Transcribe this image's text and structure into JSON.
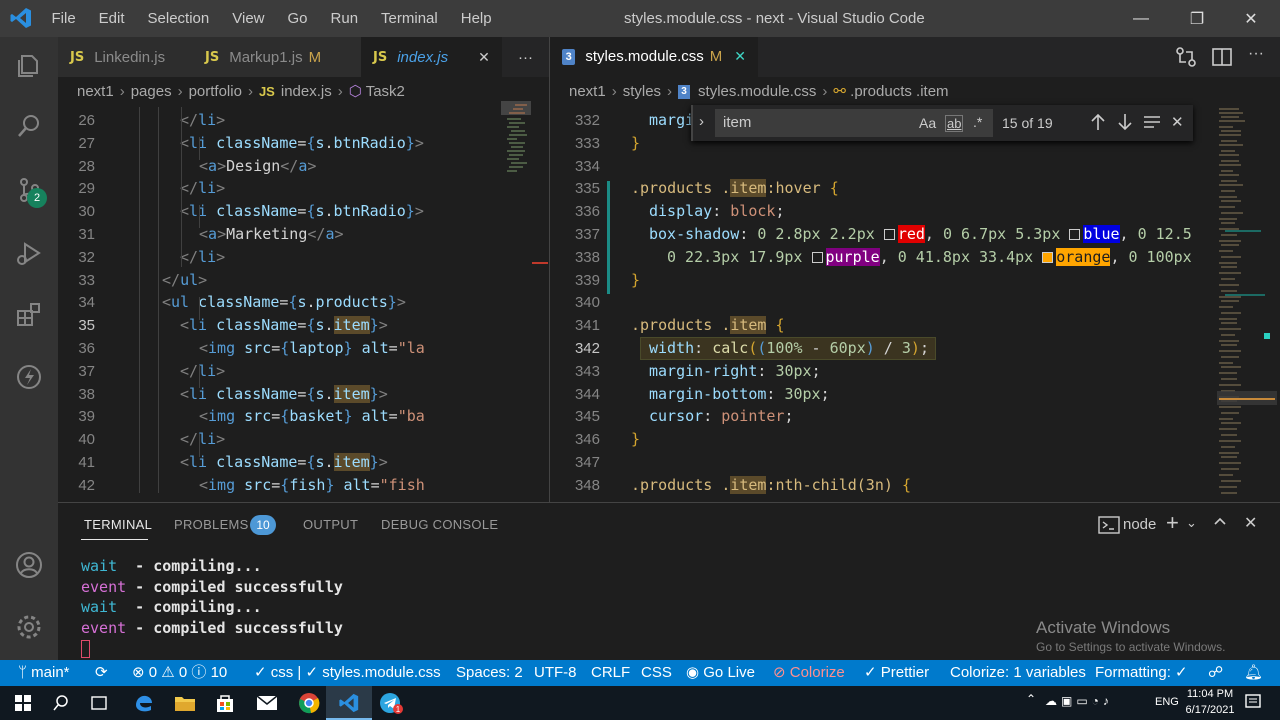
{
  "titlebar": {
    "menu": [
      "File",
      "Edit",
      "Selection",
      "View",
      "Go",
      "Run",
      "Terminal",
      "Help"
    ],
    "title": "styles.module.css - next - Visual Studio Code",
    "min": "—",
    "max": "❐",
    "close": "✕"
  },
  "left_tabs": [
    {
      "icon": "JS",
      "label": "Linkedin.js",
      "mod": ""
    },
    {
      "icon": "JS",
      "label": "Markup1.js",
      "mod": "M"
    },
    {
      "icon": "JS",
      "label": "index.js",
      "mod": "",
      "close": "✕"
    }
  ],
  "left_more": "···",
  "left_crumbs": {
    "a": "next1",
    "b": "pages",
    "c": "portfolio",
    "d": "JS",
    "e": "index.js",
    "f": "Task2"
  },
  "left_code": [
    {
      "n": "26",
      "h": "<span class='tg'>&lt;/</span><span class='tn'>li</span><span class='tg'>&gt;</span>",
      "i": 180
    },
    {
      "n": "27",
      "h": "<span class='tg'>&lt;</span><span class='tn'>li</span> <span class='at'>className</span><span class='tx'>=</span><span class='tn'>{</span><span class='vr'>s</span><span class='tx'>.</span><span class='vr'>btnRadio</span><span class='tn'>}</span><span class='tg'>&gt;</span>",
      "i": 180
    },
    {
      "n": "28",
      "h": "<span class='tg'>&lt;</span><span class='tn'>a</span><span class='tg'>&gt;</span><span class='tx'>Design</span><span class='tg'>&lt;/</span><span class='tn'>a</span><span class='tg'>&gt;</span>",
      "i": 199
    },
    {
      "n": "29",
      "h": "<span class='tg'>&lt;/</span><span class='tn'>li</span><span class='tg'>&gt;</span>",
      "i": 180
    },
    {
      "n": "30",
      "h": "<span class='tg'>&lt;</span><span class='tn'>li</span> <span class='at'>className</span><span class='tx'>=</span><span class='tn'>{</span><span class='vr'>s</span><span class='tx'>.</span><span class='vr'>btnRadio</span><span class='tn'>}</span><span class='tg'>&gt;</span>",
      "i": 180
    },
    {
      "n": "31",
      "h": "<span class='tg'>&lt;</span><span class='tn'>a</span><span class='tg'>&gt;</span><span class='tx'>Marketing</span><span class='tg'>&lt;/</span><span class='tn'>a</span><span class='tg'>&gt;</span>",
      "i": 199
    },
    {
      "n": "32",
      "h": "<span class='tg'>&lt;/</span><span class='tn'>li</span><span class='tg'>&gt;</span>",
      "i": 180
    },
    {
      "n": "33",
      "h": "<span class='tg'>&lt;/</span><span class='tn'>ul</span><span class='tg'>&gt;</span>",
      "i": 162
    },
    {
      "n": "34",
      "h": "<span class='tg'>&lt;</span><span class='tn'>ul</span> <span class='at'>className</span><span class='tx'>=</span><span class='tn'>{</span><span class='vr'>s</span><span class='tx'>.</span><span class='vr'>products</span><span class='tn'>}</span><span class='tg'>&gt;</span>",
      "i": 162
    },
    {
      "n": "35",
      "h": "<span class='tg'>&lt;</span><span class='tn'>li</span> <span class='at'>className</span><span class='tx'>=</span><span class='tn'>{</span><span class='vr'>s</span><span class='tx'>.</span><span class='vr hl'>item</span><span class='tn'>}</span><span class='tg'>&gt;</span>",
      "i": 180,
      "cur": true
    },
    {
      "n": "36",
      "h": "<span class='tg'>&lt;</span><span class='tn'>img</span> <span class='at'>src</span><span class='tx'>=</span><span class='tn'>{</span><span class='vr'>laptop</span><span class='tn'>}</span> <span class='at'>alt</span><span class='tx'>=</span><span class='st'>\"la</span>",
      "i": 199
    },
    {
      "n": "37",
      "h": "<span class='tg'>&lt;/</span><span class='tn'>li</span><span class='tg'>&gt;</span>",
      "i": 180
    },
    {
      "n": "38",
      "h": "<span class='tg'>&lt;</span><span class='tn'>li</span> <span class='at'>className</span><span class='tx'>=</span><span class='tn'>{</span><span class='vr'>s</span><span class='tx'>.</span><span class='vr hl'>item</span><span class='tn'>}</span><span class='tg'>&gt;</span>",
      "i": 180
    },
    {
      "n": "39",
      "h": "<span class='tg'>&lt;</span><span class='tn'>img</span> <span class='at'>src</span><span class='tx'>=</span><span class='tn'>{</span><span class='vr'>basket</span><span class='tn'>}</span> <span class='at'>alt</span><span class='tx'>=</span><span class='st'>\"ba</span>",
      "i": 199
    },
    {
      "n": "40",
      "h": "<span class='tg'>&lt;/</span><span class='tn'>li</span><span class='tg'>&gt;</span>",
      "i": 180
    },
    {
      "n": "41",
      "h": "<span class='tg'>&lt;</span><span class='tn'>li</span> <span class='at'>className</span><span class='tx'>=</span><span class='tn'>{</span><span class='vr'>s</span><span class='tx'>.</span><span class='vr hl'>item</span><span class='tn'>}</span><span class='tg'>&gt;</span>",
      "i": 180
    },
    {
      "n": "42",
      "h": "<span class='tg'>&lt;</span><span class='tn'>img</span> <span class='at'>src</span><span class='tx'>=</span><span class='tn'>{</span><span class='vr'>fish</span><span class='tn'>}</span> <span class='at'>alt</span><span class='tx'>=</span><span class='st'>\"fish</span>",
      "i": 199
    }
  ],
  "right_tab": {
    "icon": "3",
    "label": "styles.module.css",
    "mod": "M",
    "close": "✕"
  },
  "right_crumbs": {
    "a": "next1",
    "b": "styles",
    "c": "styles.module.css",
    "d": ".products .item"
  },
  "right_code": [
    {
      "n": "332",
      "h": "<span class='pr'>margi</span>",
      "i": 648
    },
    {
      "n": "333",
      "h": "<span class='br'>}</span>",
      "i": 630
    },
    {
      "n": "334",
      "h": "",
      "i": 630
    },
    {
      "n": "335",
      "h": "<span class='sel'>.products</span> <span class='sel'>.<span class='hl'>item</span>:hover</span> <span class='br'>{</span>",
      "i": 630
    },
    {
      "n": "336",
      "h": "<span class='pr'>display</span><span class='tx'>: </span><span class='kw'>block</span><span class='tx'>;</span>",
      "i": 648
    },
    {
      "n": "337",
      "h": "<span class='pr'>box-shadow</span><span class='tx'>: </span><span class='nm'>0 2.8px 2.2px</span> <span class='sw' style='border-color:#ff0000'></span><span class='kw' style='background:#e00000;color:#fff'>red</span><span class='tx'>, </span><span class='nm'>0 6.7px 5.3px</span> <span class='sw' style='border-color:#0000ff'></span><span class='kw' style='background:#0000e0;color:#fff'>blue</span><span class='tx'>, </span><span class='nm'>0 12.5</span>",
      "i": 648
    },
    {
      "n": "338",
      "h": "<span class='nm'>0 22.3px 17.9px</span> <span class='sw' style='border-color:#800080'></span><span class='kw' style='background:#800080;color:#fff'>purple</span><span class='tx'>, </span><span class='nm'>0 41.8px 33.4px</span> <span class='sw' style='border-color:#ffa500;background:#ffa500'></span><span class='kw' style='background:#ffa500;color:#1e1e1e'>orange</span><span class='tx'>, </span><span class='nm'>0 100px</span>",
      "i": 666
    },
    {
      "n": "339",
      "h": "<span class='br'>}</span>",
      "i": 630
    },
    {
      "n": "340",
      "h": "",
      "i": 630
    },
    {
      "n": "341",
      "h": "<span class='sel'>.products</span> <span class='sel'>.<span class='hl'>item</span></span> <span class='br'>{</span>",
      "i": 630
    },
    {
      "n": "342",
      "h": "<span class='pr'>width</span><span class='tx'>: </span><span class='fn'>calc</span><span class='br'>(</span><span class='tn'>(</span><span class='nm'>100%</span><span class='tx'> - </span><span class='nm'>60px</span><span class='tn'>)</span><span class='tx'> / </span><span class='nm'>3</span><span class='br'>)</span><span class='tx'>;</span>",
      "i": 648,
      "cur": true
    },
    {
      "n": "343",
      "h": "<span class='pr'>margin-right</span><span class='tx'>: </span><span class='nm'>30px</span><span class='tx'>;</span>",
      "i": 648
    },
    {
      "n": "344",
      "h": "<span class='pr'>margin-bottom</span><span class='tx'>: </span><span class='nm'>30px</span><span class='tx'>;</span>",
      "i": 648
    },
    {
      "n": "345",
      "h": "<span class='pr'>cursor</span><span class='tx'>: </span><span class='kw'>pointer</span><span class='tx'>;</span>",
      "i": 648
    },
    {
      "n": "346",
      "h": "<span class='br'>}</span>",
      "i": 630
    },
    {
      "n": "347",
      "h": "",
      "i": 630
    },
    {
      "n": "348",
      "h": "<span class='sel'>.products</span> <span class='sel'>.<span class='hl'>item</span>:nth-child(3n)</span> <span class='br'>{</span>",
      "i": 630
    }
  ],
  "find": {
    "value": "item",
    "case": "Aa",
    "word": "ab",
    "regex": ".*",
    "count": "15 of 19"
  },
  "panel": {
    "tabs": [
      "TERMINAL",
      "PROBLEMS",
      "OUTPUT",
      "DEBUG CONSOLE"
    ],
    "problems_count": "10",
    "shell": "node"
  },
  "terminal": [
    {
      "a": "wait",
      "b": "  - compiling..."
    },
    {
      "a": "event",
      "b": " - compiled successfully"
    },
    {
      "a": "wait",
      "b": "  - compiling..."
    },
    {
      "a": "event",
      "b": " - compiled successfully"
    }
  ],
  "watermark": {
    "title": "Activate Windows",
    "sub": "Go to Settings to activate Windows."
  },
  "status": {
    "branch": "main*",
    "errors": "0",
    "warnings": "0",
    "info": "10",
    "lang_check": "css | ✓ styles.module.css",
    "spaces": "Spaces: 2",
    "enc": "UTF-8",
    "eol": "CRLF",
    "mode": "CSS",
    "golive": "Go Live",
    "colorize": "Colorize",
    "prettier": "Prettier",
    "colorize_vars": "Colorize: 1 variables",
    "formatting": "Formatting: ✓"
  },
  "tray": {
    "lang": "ENG",
    "time": "11:04 PM",
    "date": "6/17/2021"
  },
  "colors": {
    "accent": "#007acc",
    "titlebar": "#3c3c3c",
    "activity": "#333333",
    "editor": "#1e1e1e"
  }
}
